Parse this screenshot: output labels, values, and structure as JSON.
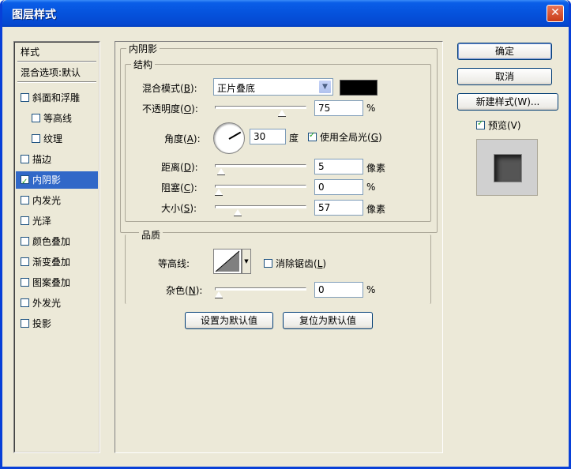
{
  "window": {
    "title": "图层样式",
    "close": "✕"
  },
  "style_list": {
    "header": "样式",
    "blend_options": "混合选项:默认",
    "items": [
      {
        "label": "斜面和浮雕",
        "checked": false,
        "sub": false
      },
      {
        "label": "等高线",
        "checked": false,
        "sub": true
      },
      {
        "label": "纹理",
        "checked": false,
        "sub": true
      },
      {
        "label": "描边",
        "checked": false,
        "sub": false
      },
      {
        "label": "内阴影",
        "checked": true,
        "sub": false,
        "selected": true
      },
      {
        "label": "内发光",
        "checked": false,
        "sub": false
      },
      {
        "label": "光泽",
        "checked": false,
        "sub": false
      },
      {
        "label": "颜色叠加",
        "checked": false,
        "sub": false
      },
      {
        "label": "渐变叠加",
        "checked": false,
        "sub": false
      },
      {
        "label": "图案叠加",
        "checked": false,
        "sub": false
      },
      {
        "label": "外发光",
        "checked": false,
        "sub": false
      },
      {
        "label": "投影",
        "checked": false,
        "sub": false
      }
    ]
  },
  "panel": {
    "section_title": "内阴影",
    "structure_title": "结构",
    "blend_mode": {
      "label": "混合模式",
      "key": "B",
      "value": "正片叠底"
    },
    "color": "#000000",
    "opacity": {
      "label": "不透明度",
      "key": "O",
      "value": "75",
      "unit": "%",
      "fraction": 0.75
    },
    "angle": {
      "label": "角度",
      "key": "A",
      "value": "30",
      "unit": "度",
      "global_light_label": "使用全局光",
      "global_light_key": "G",
      "global_light_checked": true
    },
    "distance": {
      "label": "距离",
      "key": "D",
      "value": "5",
      "unit": "像素",
      "fraction": 0.03
    },
    "choke": {
      "label": "阻塞",
      "key": "C",
      "value": "0",
      "unit": "%",
      "fraction": 0.0
    },
    "size": {
      "label": "大小",
      "key": "S",
      "value": "57",
      "unit": "像素",
      "fraction": 0.23
    },
    "quality_title": "品质",
    "contour": {
      "label": "等高线",
      "antialias_label": "消除锯齿",
      "antialias_key": "L",
      "antialias_checked": false
    },
    "noise": {
      "label": "杂色",
      "key": "N",
      "value": "0",
      "unit": "%",
      "fraction": 0.0
    },
    "set_default": "设置为默认值",
    "reset_default": "复位为默认值"
  },
  "buttons": {
    "ok": "确定",
    "cancel": "取消",
    "new_style": "新建样式(W)...",
    "preview_label": "预览(V)",
    "preview_checked": true
  }
}
